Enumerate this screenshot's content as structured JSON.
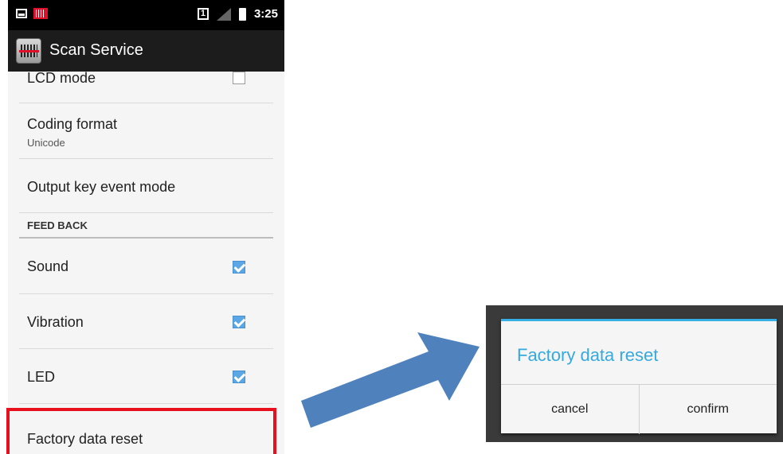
{
  "status_bar": {
    "sim_label": "1",
    "time": "3:25"
  },
  "app_bar": {
    "title": "Scan Service"
  },
  "settings": {
    "lcd_mode": {
      "label": "LCD mode",
      "checked": false
    },
    "coding_format": {
      "label": "Coding format",
      "value": "Unicode"
    },
    "output_key_event": {
      "label": "Output key event mode"
    },
    "section_feedback": "FEED BACK",
    "sound": {
      "label": "Sound",
      "checked": true
    },
    "vibration": {
      "label": "Vibration",
      "checked": true
    },
    "led": {
      "label": "LED",
      "checked": true
    },
    "factory_reset": {
      "label": "Factory data reset"
    }
  },
  "dialog": {
    "title": "Factory data reset",
    "cancel_label": "cancel",
    "confirm_label": "confirm"
  },
  "colors": {
    "accent": "#36a9df",
    "highlight": "#e8101c",
    "arrow": "#4f81bd"
  }
}
